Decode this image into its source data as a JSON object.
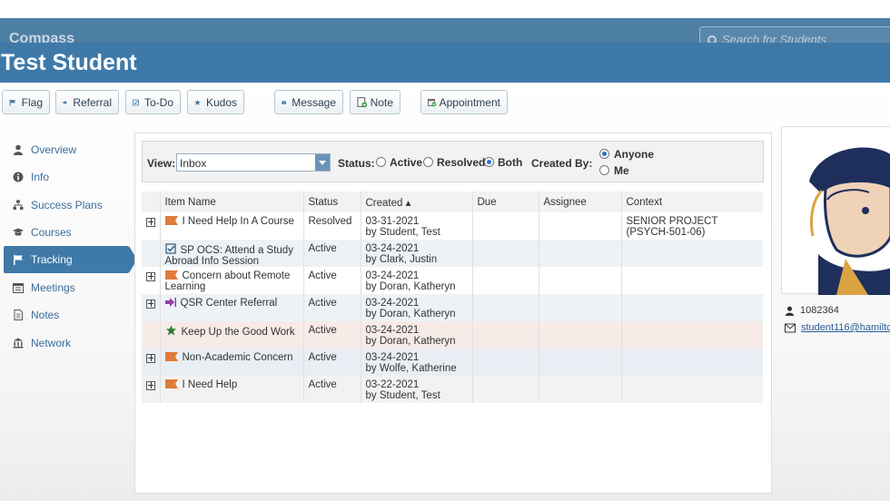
{
  "app": {
    "name": "Compass",
    "search_placeholder": "Search for Students"
  },
  "student": {
    "name": "Test Student",
    "id": "1082364",
    "email": "student116@hamiltc"
  },
  "toolbar": {
    "flag": "Flag",
    "referral": "Referral",
    "todo": "To-Do",
    "kudos": "Kudos",
    "message": "Message",
    "note": "Note",
    "appointment": "Appointment"
  },
  "nav": [
    {
      "label": "Overview",
      "icon": "user-icon"
    },
    {
      "label": "Info",
      "icon": "info-icon"
    },
    {
      "label": "Success Plans",
      "icon": "sitemap-icon"
    },
    {
      "label": "Courses",
      "icon": "graduation-cap-icon"
    },
    {
      "label": "Tracking",
      "icon": "flag-icon",
      "active": true
    },
    {
      "label": "Meetings",
      "icon": "calendar-icon"
    },
    {
      "label": "Notes",
      "icon": "document-icon"
    },
    {
      "label": "Network",
      "icon": "bank-icon"
    }
  ],
  "filters": {
    "view_label": "View:",
    "view_value": "Inbox",
    "status_label": "Status:",
    "status_options": [
      "Active",
      "Resolved",
      "Both"
    ],
    "status_selected": "Both",
    "created_by_label": "Created By:",
    "created_by_options": [
      "Anyone",
      "Me"
    ],
    "created_by_selected": "Anyone"
  },
  "table": {
    "columns": [
      "Item Name",
      "Status",
      "Created ▴",
      "Due",
      "Assignee",
      "Context"
    ],
    "rows": [
      {
        "expandable": true,
        "icon": "orange-flag-icon",
        "name": "I Need Help In A Course",
        "status": "Resolved",
        "created_date": "03-31-2021",
        "created_by": "by Student, Test",
        "due": "",
        "assignee": "",
        "context": "SENIOR PROJECT (PSYCH-501-06)"
      },
      {
        "expandable": false,
        "icon": "checkbox-icon",
        "name": "SP OCS: Attend a Study Abroad Info Session",
        "status": "Active",
        "created_date": "03-24-2021",
        "created_by": "by Clark, Justin",
        "due": "",
        "assignee": "",
        "context": ""
      },
      {
        "expandable": true,
        "icon": "orange-flag-icon",
        "name": "Concern about Remote Learning",
        "status": "Active",
        "created_date": "03-24-2021",
        "created_by": "by Doran, Katheryn",
        "due": "",
        "assignee": "",
        "context": ""
      },
      {
        "expandable": true,
        "icon": "purple-referral-icon",
        "name": "QSR Center Referral",
        "status": "Active",
        "created_date": "03-24-2021",
        "created_by": "by Doran, Katheryn",
        "due": "",
        "assignee": "",
        "context": ""
      },
      {
        "expandable": false,
        "icon": "green-star-icon",
        "name": "Keep Up the Good Work",
        "status": "Active",
        "created_date": "03-24-2021",
        "created_by": "by Doran, Katheryn",
        "due": "",
        "assignee": "",
        "context": ""
      },
      {
        "expandable": true,
        "icon": "orange-flag-icon",
        "name": "Non-Academic Concern",
        "status": "Active",
        "created_date": "03-24-2021",
        "created_by": "by Wolfe, Katherine",
        "due": "",
        "assignee": "",
        "context": ""
      },
      {
        "expandable": true,
        "icon": "orange-flag-icon",
        "name": "I Need Help",
        "status": "Active",
        "created_date": "03-22-2021",
        "created_by": "by Student, Test",
        "due": "",
        "assignee": "",
        "context": ""
      }
    ]
  },
  "colors": {
    "header": "#3f79a8",
    "flag": "#e07b39",
    "star": "#2e7d32",
    "referral": "#8e3fa8"
  }
}
